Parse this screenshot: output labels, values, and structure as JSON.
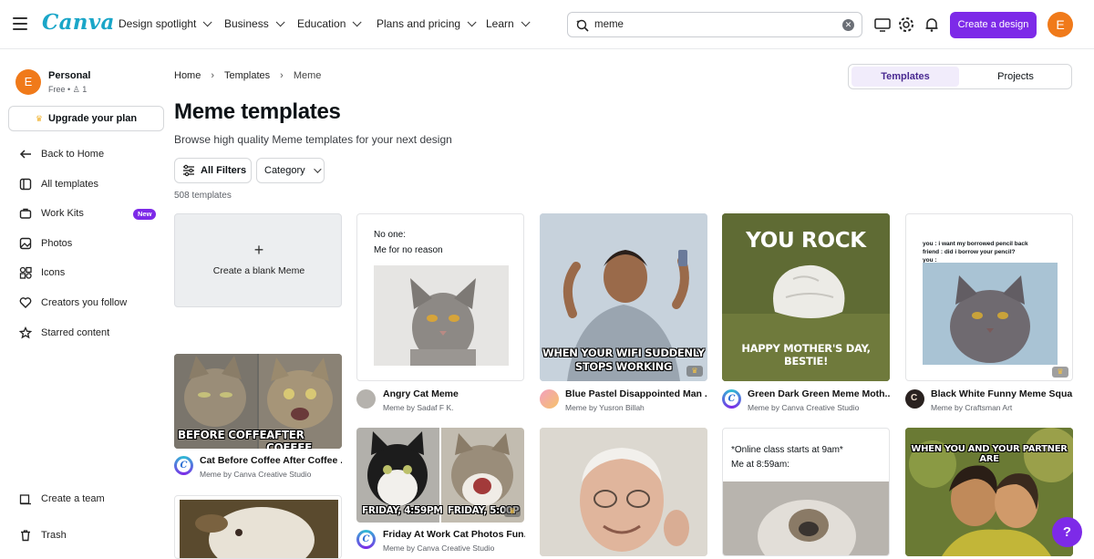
{
  "topbar": {
    "logo": "Canva",
    "nav": [
      "Design spotlight",
      "Business",
      "Education",
      "Plans and pricing",
      "Learn"
    ],
    "search_value": "meme",
    "create_label": "Create a design",
    "avatar_letter": "E"
  },
  "sidebar": {
    "avatar_letter": "E",
    "name": "Personal",
    "plan": "Free • ",
    "member_count": "1",
    "upgrade": "Upgrade your plan",
    "items": [
      "Back to Home",
      "All templates",
      "Work Kits",
      "Photos",
      "Icons",
      "Creators you follow",
      "Starred content"
    ],
    "new_badge": "New",
    "bottom": [
      "Create a team",
      "Trash"
    ]
  },
  "main": {
    "breadcrumbs": [
      "Home",
      "Templates",
      "Meme"
    ],
    "tabs": [
      "Templates",
      "Projects"
    ],
    "title": "Meme templates",
    "subtitle": "Browse high quality Meme templates for your next design",
    "all_filters": "All Filters",
    "category": "Category",
    "count": "508 templates",
    "blank_card": "Create a blank Meme"
  },
  "cards": [
    {
      "title": "Angry Cat Meme",
      "by": "Meme by Sadaf F K.",
      "top1": "No one:",
      "top2": "Me for no reason"
    },
    {
      "title": "Blue Pastel Disappointed Man ...",
      "by": "Meme by Yusron Billah",
      "caption1": "WHEN YOUR WIFI SUDDENLY",
      "caption2": "STOPS WORKING"
    },
    {
      "title": "Green Dark Green Meme Moth...",
      "by": "Meme by Canva Creative Studio",
      "top": "YOU ROCK",
      "bottom": "HAPPY MOTHER'S DAY, BESTIE!"
    },
    {
      "title": "Black White Funny Meme Squa...",
      "by": "Meme by Craftsman Art",
      "text1": "you : i want my borrowed pencil back",
      "text2": "friend : did i borrow your pencil?",
      "text3": "you :"
    },
    {
      "title": "Cat Before Coffee After Coffee ...",
      "by": "Meme by Canva Creative Studio",
      "left": "BEFORE COFFEE",
      "right": "AFTER COFFEE"
    },
    {
      "title": "Friday At Work Cat Photos Fun...",
      "by": "Meme by Canva Creative Studio",
      "left": "FRIDAY, 4:59PM",
      "right": "FRIDAY, 5:00P"
    },
    {
      "top1": "*Online class starts at 9am*",
      "top2": "Me at 8:59am:"
    },
    {
      "top": "WHEN YOU AND YOUR PARTNER ARE"
    }
  ],
  "help": "?"
}
